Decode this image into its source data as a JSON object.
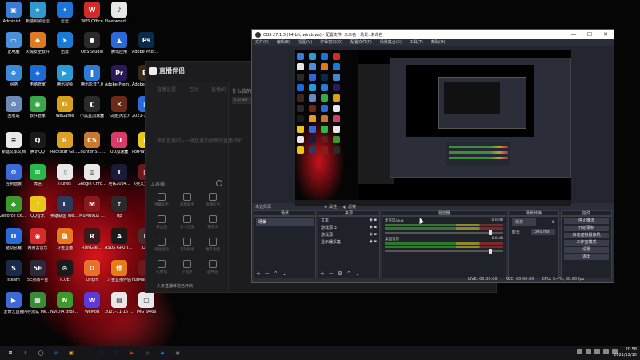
{
  "desktop_icons": [
    {
      "label": "Administ...",
      "color": "#3a7bd5",
      "glyph": "▣"
    },
    {
      "label": "新疆照顾逗逗",
      "color": "#2e9ad0",
      "glyph": "★"
    },
    {
      "label": "逗逗",
      "color": "#1e73d8",
      "glyph": "✦"
    },
    {
      "label": "WPS Office",
      "color": "#d42a2a",
      "glyph": "W"
    },
    {
      "label": "Fleetwood Mac - T...",
      "color": "#e6e6e6",
      "glyph": "♪"
    },
    {
      "label": "此电脑",
      "color": "#4a8fd8",
      "glyph": "▭"
    },
    {
      "label": "火绒安全软件",
      "color": "#e07a20",
      "glyph": "◆"
    },
    {
      "label": "迅雷",
      "color": "#1a7ad8",
      "glyph": "➤"
    },
    {
      "label": "OBS Studio",
      "color": "#2a2a2a",
      "glyph": "●"
    },
    {
      "label": "腾讯应用",
      "color": "#2a6ad8",
      "glyph": "▲"
    },
    {
      "label": "Adobe Photosh...",
      "color": "#0a2a4a",
      "glyph": "Ps"
    },
    {
      "label": "网络",
      "color": "#3a8ad8",
      "glyph": "⊕"
    },
    {
      "label": "电脑管家",
      "color": "#1a6ad8",
      "glyph": "◈"
    },
    {
      "label": "腾讯视频",
      "color": "#2a9ad8",
      "glyph": "▶"
    },
    {
      "label": "腾讯影音7.0",
      "color": "#2a7ad8",
      "glyph": "❚"
    },
    {
      "label": "Adobe Premie...",
      "color": "#2a1a5a",
      "glyph": "Pr"
    },
    {
      "label": "Adobe Bridge ...",
      "color": "#3a2a1a",
      "glyph": "Br"
    },
    {
      "label": "回收站",
      "color": "#6a8ab8",
      "glyph": "♻"
    },
    {
      "label": "软件管家",
      "color": "#3aa84a",
      "glyph": "◉"
    },
    {
      "label": "WeGame",
      "color": "#d8a01a",
      "glyph": "G"
    },
    {
      "label": "小黑盒加速器",
      "color": "#2a2a2a",
      "glyph": "◐"
    },
    {
      "label": "《战胜风云》",
      "color": "#6a2a1a",
      "glyph": "✕"
    },
    {
      "label": "2021-11-15 14-51-...",
      "color": "#2a6ad8",
      "glyph": "▤"
    },
    {
      "label": "新建文本文档",
      "color": "#e8e8e8",
      "glyph": "≡"
    },
    {
      "label": "腾讯QQ",
      "color": "#1a1a1a",
      "glyph": "Q"
    },
    {
      "label": "Rockstar Games...",
      "color": "#e0a020",
      "glyph": "R"
    },
    {
      "label": "Counter-S... Global Off...",
      "color": "#c87a2a",
      "glyph": "CS"
    },
    {
      "label": "UU加速器",
      "color": "#d83a6a",
      "glyph": "U"
    },
    {
      "label": "PotPlayer 64 bit",
      "color": "#e8c81a",
      "glyph": "▶"
    },
    {
      "label": "控制面板",
      "color": "#3a6ad8",
      "glyph": "⚙"
    },
    {
      "label": "微信",
      "color": "#2ab84a",
      "glyph": "✉"
    },
    {
      "label": "iTunes",
      "color": "#e8e8e8",
      "glyph": "♫"
    },
    {
      "label": "Google Chrome",
      "color": "#e8e8e8",
      "glyph": "◎"
    },
    {
      "label": "地铁2034...",
      "color": "#1a1a3a",
      "glyph": "T"
    },
    {
      "label": "《英文大会》Dance o...",
      "color": "#6a1a1a",
      "glyph": "▣"
    },
    {
      "label": "GeForce Experience",
      "color": "#3a9a2a",
      "glyph": "◆"
    },
    {
      "label": "QQ音乐",
      "color": "#e8c81a",
      "glyph": "♪"
    },
    {
      "label": "英雄联盟 WeGame版",
      "color": "#2a3a5a",
      "glyph": "L"
    },
    {
      "label": "MuMuVOX ...",
      "color": "#8a1a1a",
      "glyph": "M"
    },
    {
      "label": "Up",
      "color": "#2a2a2a",
      "glyph": "↑"
    },
    {
      "label": "驱动总裁",
      "color": "#2a6ad8",
      "glyph": "D"
    },
    {
      "label": "网易云音乐",
      "color": "#d82a2a",
      "glyph": "◉"
    },
    {
      "label": "斗鱼直播",
      "color": "#e87a1a",
      "glyph": "鱼"
    },
    {
      "label": "RUNGTei...",
      "color": "#3a1a1a",
      "glyph": "R"
    },
    {
      "label": "ASUS GPU Tweak II",
      "color": "#1a1a1a",
      "glyph": "A"
    },
    {
      "label": "Dior",
      "color": "#4a2a2a",
      "glyph": "D"
    },
    {
      "label": "steam",
      "color": "#1a2a4a",
      "glyph": "S"
    },
    {
      "label": "5E对战平台",
      "color": "#2a2a3a",
      "glyph": "5E"
    },
    {
      "label": "iCUE",
      "color": "#1a1a1a",
      "glyph": "⊙"
    },
    {
      "label": "Origin",
      "color": "#e8702a",
      "glyph": "O"
    },
    {
      "label": "斗鱼直播伴侣",
      "color": "#e87a1a",
      "glyph": "伴"
    },
    {
      "label": "FurMark ROG Editi...",
      "color": "#6a1a1a",
      "glyph": "F"
    },
    {
      "label": "爱奇艺直播",
      "color": "#3a6ad8",
      "glyph": "▶"
    },
    {
      "label": "内存测试 MemTest...",
      "color": "#3a8a3a",
      "glyph": "▦"
    },
    {
      "label": "NVIDIA Broadcast",
      "color": "#3a9a2a",
      "glyph": "N"
    },
    {
      "label": "WeMod",
      "color": "#5a3ad8",
      "glyph": "W"
    },
    {
      "label": "2021-11-15 23-09-57",
      "color": "#e8e8e8",
      "glyph": "▤"
    },
    {
      "label": "IMG_9466",
      "color": "#e8e8e8",
      "glyph": "▢"
    }
  ],
  "mid_app": {
    "brand": "直播伴侣",
    "tabs": [
      "直播设置",
      "互动",
      "直播间"
    ],
    "subtitle": "什么我的直播间",
    "subpill": "CS:GO",
    "hint": "添加直播间~一键直播加载新的直播开拍",
    "toolbox": "工具箱",
    "tools": [
      "弹幕助手",
      "观看助手",
      "直播任务",
      "粉丝团",
      "多人连麦",
      "摄像头",
      "商品橱窗",
      "音效助手",
      "更多功能",
      "礼物墙",
      "小程序",
      "画中画"
    ],
    "notice": "头条直播体验已开启"
  },
  "obs": {
    "title": "OBS 27.1.3 (64-bit, windows) - 配置文件: 未命名 - 场景: 未命名",
    "window_controls": [
      "—",
      "☐",
      "✕"
    ],
    "menu": [
      "文件(F)",
      "编辑(E)",
      "视图(V)",
      "停靠窗口(D)",
      "配置文件(P)",
      "场景集合(S)",
      "工具(T)",
      "帮助(H)"
    ],
    "scene_tag": "未选择源",
    "preview_tools": [
      "属性",
      "滤镜"
    ],
    "docks": {
      "scenes": {
        "header": "场景",
        "items": [
          "场景"
        ]
      },
      "sources": {
        "header": "来源",
        "items": [
          "文本",
          "游戏源 3",
          "游戏源",
          "显示器采集"
        ]
      },
      "mixer": {
        "header": "混音器",
        "channels": [
          {
            "name": "麦克风/Aux",
            "db": "0.0 dB"
          },
          {
            "name": "桌面音频",
            "db": "0.0 dB"
          }
        ]
      },
      "transitions": {
        "header": "场景转换",
        "mode": "渐变",
        "duration_label": "时长",
        "duration": "300 ms"
      },
      "controls": {
        "header": "控件",
        "buttons": [
          "停止推流",
          "开始录制",
          "启动虚拟摄像机",
          "工作室模式",
          "设置",
          "退出"
        ]
      }
    },
    "status": [
      "LIVE: 00:00:00",
      "REC: 00:00:00",
      "CPU: 5.4%, 60.00 fps"
    ]
  },
  "taskbar": {
    "icons": [
      "⊞",
      "⌕",
      "◯",
      "e",
      "▣",
      "Q",
      "Ps",
      "Pr",
      "▶",
      "●",
      "◆",
      "◉"
    ],
    "time": "20:58",
    "date": "2021/12/10"
  }
}
